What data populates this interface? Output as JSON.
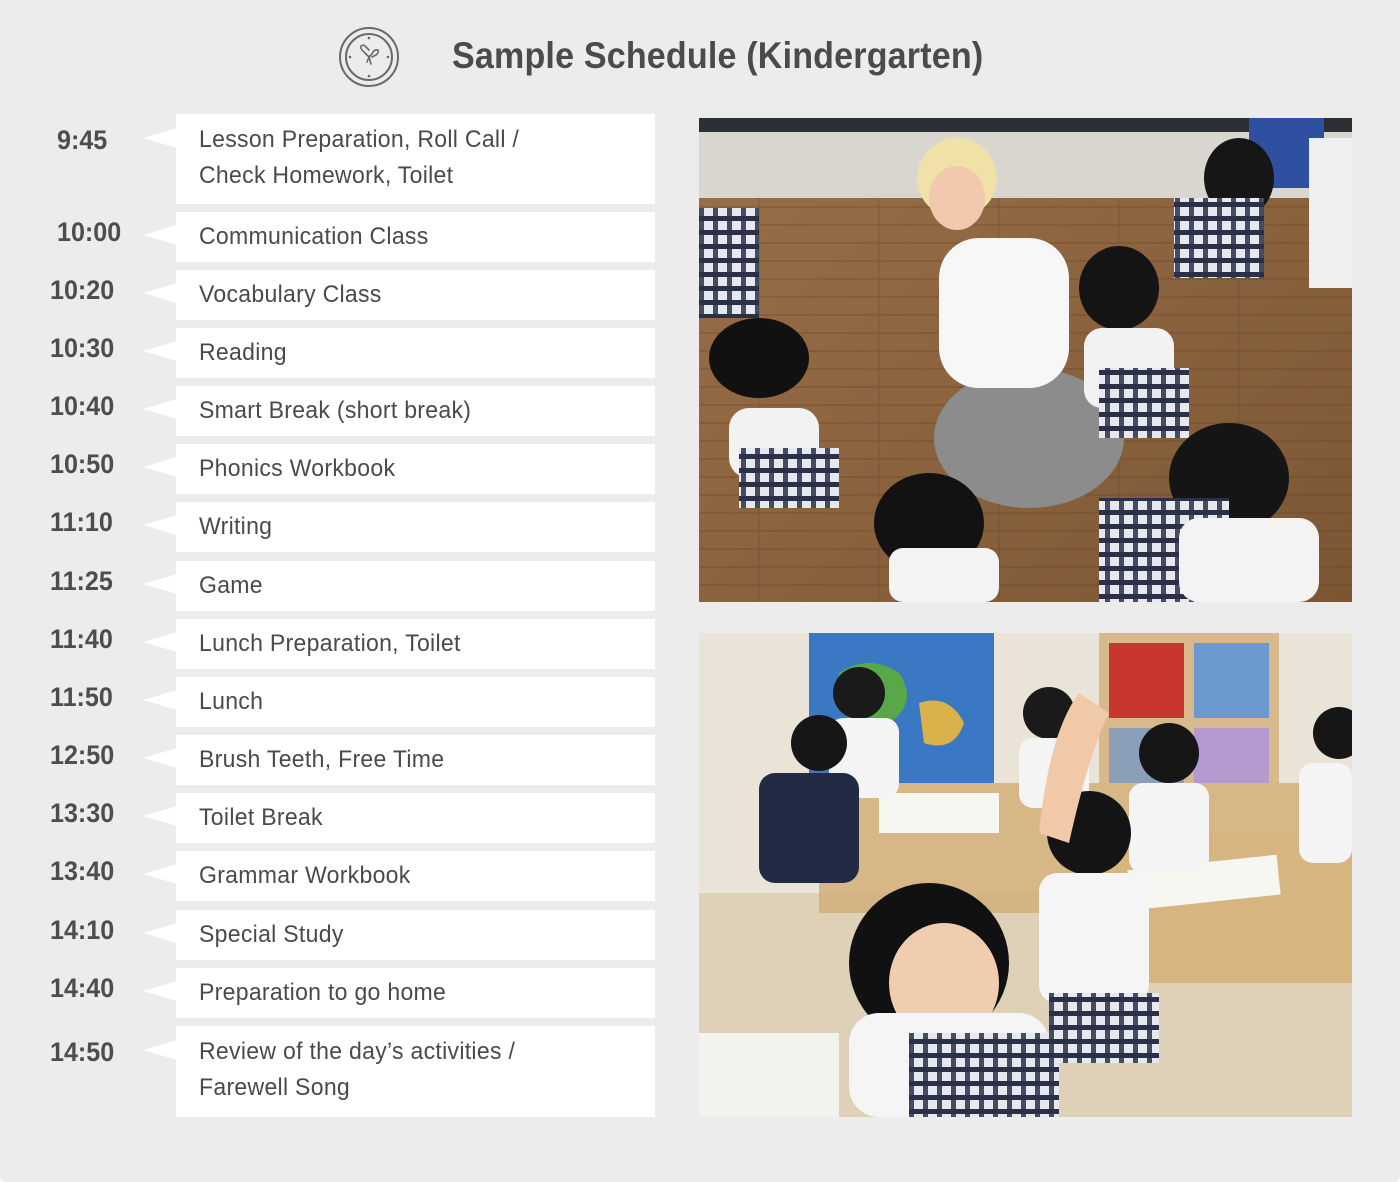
{
  "header": {
    "icon": "clock-icon",
    "title": "Sample Schedule (Kindergarten)"
  },
  "colors": {
    "background": "#ececec",
    "box": "#ffffff",
    "text": "#4a4a4a"
  },
  "schedule": [
    {
      "time": "9:45",
      "activity": "Lesson Preparation, Roll Call /\nCheck Homework, Toilet"
    },
    {
      "time": "10:00",
      "activity": "Communication Class"
    },
    {
      "time": "10:20",
      "activity": "Vocabulary Class"
    },
    {
      "time": "10:30",
      "activity": "Reading"
    },
    {
      "time": "10:40",
      "activity": "Smart Break (short break)"
    },
    {
      "time": "10:50",
      "activity": "Phonics Workbook"
    },
    {
      "time": "11:10",
      "activity": "Writing"
    },
    {
      "time": "11:25",
      "activity": "Game"
    },
    {
      "time": "11:40",
      "activity": "Lunch Preparation, Toilet"
    },
    {
      "time": "11:50",
      "activity": "Lunch"
    },
    {
      "time": "12:50",
      "activity": "Brush Teeth, Free Time"
    },
    {
      "time": "13:30",
      "activity": "Toilet Break"
    },
    {
      "time": "13:40",
      "activity": "Grammar Workbook"
    },
    {
      "time": "14:10",
      "activity": "Special Study"
    },
    {
      "time": "14:40",
      "activity": "Preparation to go home"
    },
    {
      "time": "14:50",
      "activity": "Review of the day’s activities /\nFarewell Song"
    }
  ],
  "photos": [
    {
      "name": "photo-teacher-high-five",
      "description": "Teacher high-fiving kindergarten children seated on a wooden floor"
    },
    {
      "name": "photo-classroom-raised-hand",
      "description": "Children at classroom tables, a girl raising her hand"
    }
  ]
}
